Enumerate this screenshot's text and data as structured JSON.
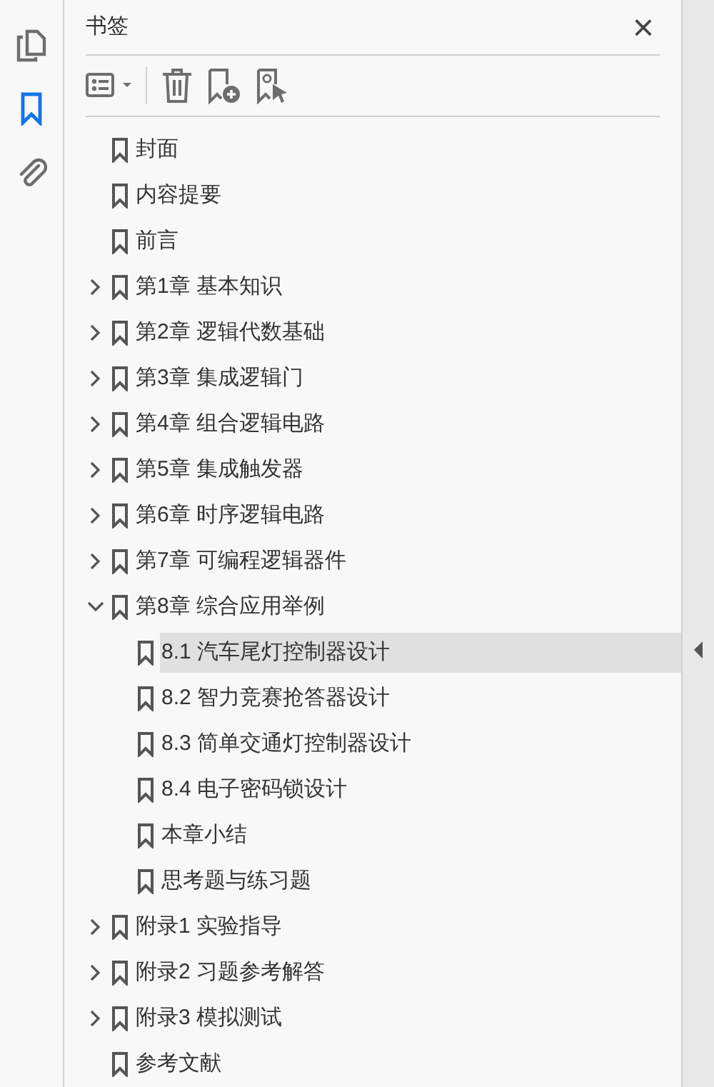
{
  "rail": [
    {
      "kind": "pages",
      "selected": false
    },
    {
      "kind": "bookmarks",
      "selected": true
    },
    {
      "kind": "attachments",
      "selected": false
    }
  ],
  "panel": {
    "title": "书签",
    "close": "×"
  },
  "toolbar": [
    {
      "kind": "options"
    },
    {
      "kind": "delete"
    },
    {
      "kind": "new"
    },
    {
      "kind": "find"
    }
  ],
  "bookmarks": [
    {
      "label": "封面",
      "selected": false
    },
    {
      "label": "内容提要",
      "selected": false
    },
    {
      "label": "前言",
      "selected": false
    },
    {
      "label": "第1章 基本知识",
      "selected": false,
      "expanded": false
    },
    {
      "label": "第2章 逻辑代数基础",
      "selected": false,
      "expanded": false
    },
    {
      "label": "第3章 集成逻辑门",
      "selected": false,
      "expanded": false
    },
    {
      "label": "第4章 组合逻辑电路",
      "selected": false,
      "expanded": false
    },
    {
      "label": "第5章 集成触发器",
      "selected": false,
      "expanded": false
    },
    {
      "label": "第6章 时序逻辑电路",
      "selected": false,
      "expanded": false
    },
    {
      "label": "第7章 可编程逻辑器件",
      "selected": false,
      "expanded": false
    },
    {
      "label": "第8章 综合应用举例",
      "selected": false,
      "expanded": true,
      "children": [
        {
          "label": "8.1 汽车尾灯控制器设计",
          "selected": true
        },
        {
          "label": "8.2 智力竞赛抢答器设计",
          "selected": false
        },
        {
          "label": "8.3 简单交通灯控制器设计",
          "selected": false
        },
        {
          "label": "8.4 电子密码锁设计",
          "selected": false
        },
        {
          "label": "本章小结",
          "selected": false
        },
        {
          "label": "思考题与练习题",
          "selected": false
        }
      ]
    },
    {
      "label": "附录1 实验指导",
      "selected": false,
      "expanded": false
    },
    {
      "label": "附录2 习题参考解答",
      "selected": false,
      "expanded": false
    },
    {
      "label": "附录3 模拟测试",
      "selected": false,
      "expanded": false
    },
    {
      "label": "参考文献",
      "selected": false
    }
  ]
}
